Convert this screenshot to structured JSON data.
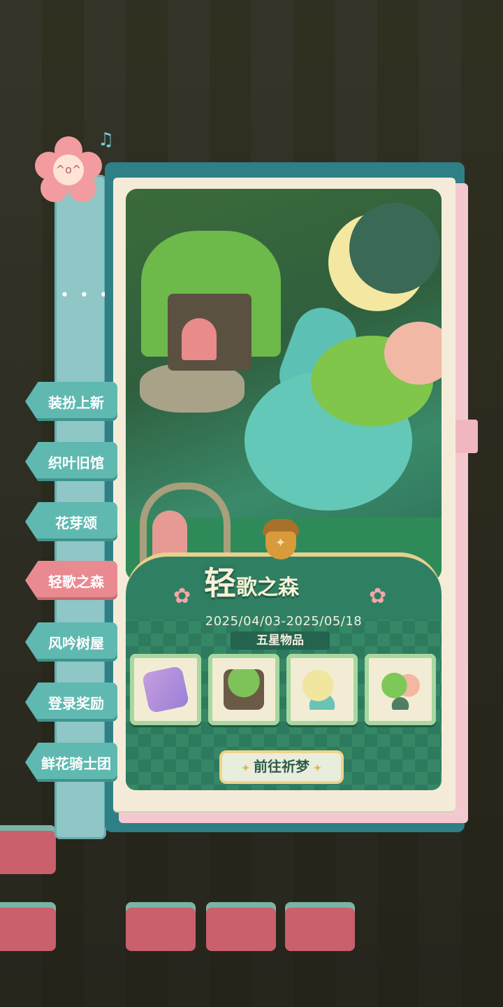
{
  "side_tabs": [
    {
      "label": "装扮上新",
      "active": false
    },
    {
      "label": "织叶旧馆",
      "active": false
    },
    {
      "label": "花芽颂",
      "active": false
    },
    {
      "label": "轻歌之森",
      "active": true
    },
    {
      "label": "风吟树屋",
      "active": false
    },
    {
      "label": "登录奖励",
      "active": false
    },
    {
      "label": "鲜花骑士团",
      "active": false
    }
  ],
  "strip_more": "• • •",
  "banner": {
    "title_big": "轻",
    "title_small_1": "歌",
    "title_small_2": "之",
    "title_small_3": "森",
    "date_range": "2025/04/03-2025/05/18",
    "ribbon_label": "五星物品"
  },
  "featured_items": [
    {
      "icon": "rug-item-icon"
    },
    {
      "icon": "treehouse-item-icon"
    },
    {
      "icon": "moon-item-icon"
    },
    {
      "icon": "tree-item-icon"
    }
  ],
  "go_button": {
    "label": "前往祈梦"
  },
  "colors": {
    "tab": "#5fb9b1",
    "tab_active": "#e98a91",
    "panel_green": "#2f7f63",
    "paper": "#f4ecd9"
  }
}
